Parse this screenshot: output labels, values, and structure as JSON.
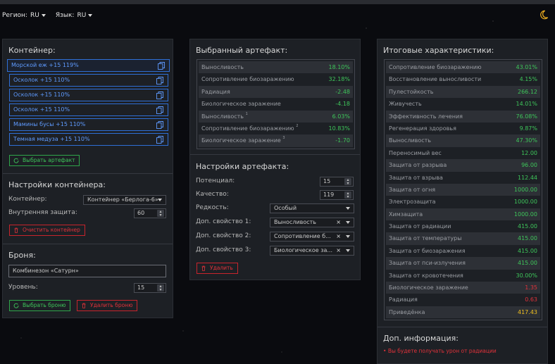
{
  "topbar": {
    "region_label": "Регион:",
    "region_value": "RU",
    "lang_label": "Язык:",
    "lang_value": "RU"
  },
  "colors": {
    "accent_blue": "#2f6fd6",
    "green": "#3ec55a",
    "red": "#e0323a",
    "yellow": "#f0c020",
    "moon": "#f0b020"
  },
  "container": {
    "title": "Контейнер:",
    "slots": [
      "Морской еж +15 119%",
      "Осколок +15 110%",
      "Осколок +15 110%",
      "Осколок +15 110%",
      "Мамины бусы +15 110%",
      "Темная медуза +15 110%"
    ],
    "select_artifact": "Выбрать артефакт"
  },
  "container_settings": {
    "title": "Настройки контейнера:",
    "container_label": "Контейнер:",
    "container_value": "Контейнер «Берлога-6»",
    "inner_label": "Внутренняя защита:",
    "inner_value": "60",
    "clear": "Очистить контейнер"
  },
  "armor": {
    "title": "Броня:",
    "name": "Комбинезон «Сатурн»",
    "level_label": "Уровень:",
    "level_value": "15",
    "select": "Выбрать броню",
    "remove": "Удалить броню"
  },
  "selected_artifact": {
    "title": "Выбранный артефакт:",
    "rows": [
      {
        "name": "Выносливость",
        "sup": "",
        "value": "18.10%",
        "color": "g"
      },
      {
        "name": "Сопротивление биозаражению",
        "sup": "",
        "value": "32.18%",
        "color": "g"
      },
      {
        "name": "Радиация",
        "sup": "",
        "value": "-2.48",
        "color": "g"
      },
      {
        "name": "Биологическое заражение",
        "sup": "",
        "value": "-4.18",
        "color": "g"
      },
      {
        "name": "Выносливость",
        "sup": "1",
        "value": "6.03%",
        "color": "g"
      },
      {
        "name": "Сопротивление биозаражению",
        "sup": "2",
        "value": "10.83%",
        "color": "g"
      },
      {
        "name": "Биологическое заражение",
        "sup": "3",
        "value": "-1.70",
        "color": "g"
      }
    ]
  },
  "artifact_settings": {
    "title": "Настройки артефакта:",
    "potential_label": "Потенциал:",
    "potential_value": "15",
    "quality_label": "Качество:",
    "quality_value": "119",
    "rarity_label": "Редкость:",
    "rarity_value": "Особый",
    "prop1_label": "Доп. свойство 1:",
    "prop1_value": "Выносливость",
    "prop2_label": "Доп. свойство 2:",
    "prop2_value": "Сопротивление б...",
    "prop3_label": "Доп. свойство 3:",
    "prop3_value": "Биологическое за...",
    "delete": "Удалить"
  },
  "totals": {
    "title": "Итоговые характеристики:",
    "rows": [
      {
        "name": "Сопротивление биозаражению",
        "value": "43.01%",
        "color": "g"
      },
      {
        "name": "Восстановление выносливости",
        "value": "4.15%",
        "color": "g"
      },
      {
        "name": "Пулестойкость",
        "value": "266.12",
        "color": "g"
      },
      {
        "name": "Живучесть",
        "value": "14.01%",
        "color": "g"
      },
      {
        "name": "Эффективность лечения",
        "value": "76.08%",
        "color": "g"
      },
      {
        "name": "Регенерация здоровья",
        "value": "9.87%",
        "color": "g"
      },
      {
        "name": "Выносливость",
        "value": "47.30%",
        "color": "g"
      },
      {
        "name": "Переносимый вес",
        "value": "12.00",
        "color": "g"
      },
      {
        "name": "Защита от разрыва",
        "value": "96.00",
        "color": "g"
      },
      {
        "name": "Защита от взрыва",
        "value": "112.44",
        "color": "g"
      },
      {
        "name": "Защита от огня",
        "value": "1000.00",
        "color": "g"
      },
      {
        "name": "Электрозащита",
        "value": "1000.00",
        "color": "g"
      },
      {
        "name": "Химзащита",
        "value": "1000.00",
        "color": "g"
      },
      {
        "name": "Защита от радиации",
        "value": "415.00",
        "color": "g"
      },
      {
        "name": "Защита от температуры",
        "value": "415.00",
        "color": "g"
      },
      {
        "name": "Защита от биозаражения",
        "value": "415.00",
        "color": "g"
      },
      {
        "name": "Защита от пси-излучения",
        "value": "415.00",
        "color": "g"
      },
      {
        "name": "Защита от кровотечения",
        "value": "30.00%",
        "color": "g"
      },
      {
        "name": "Биологическое заражение",
        "value": "1.35",
        "color": "r"
      },
      {
        "name": "Радиация",
        "value": "0.63",
        "color": "r"
      },
      {
        "name": "Приведёнка",
        "value": "417.43",
        "color": "y"
      }
    ]
  },
  "extra": {
    "title": "Доп. информация:",
    "messages": [
      "Вы будете получать урон от радиации"
    ]
  }
}
